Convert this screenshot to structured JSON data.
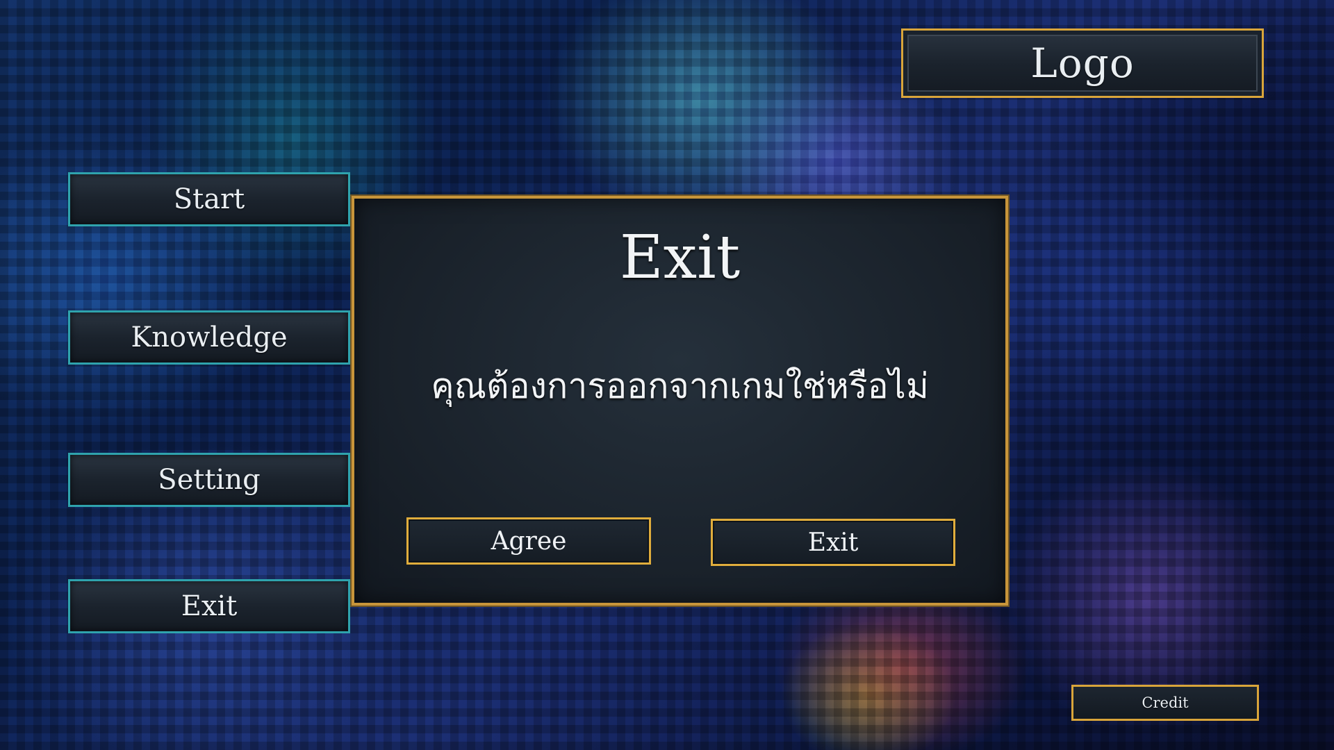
{
  "logo": {
    "label": "Logo"
  },
  "menu": {
    "items": [
      {
        "id": "start",
        "label": "Start"
      },
      {
        "id": "knowledge",
        "label": "Knowledge"
      },
      {
        "id": "setting",
        "label": "Setting"
      },
      {
        "id": "exit",
        "label": "Exit"
      }
    ]
  },
  "dialog": {
    "title": "Exit",
    "message": "คุณต้องการออกจากเกมใช่หรือไม่",
    "agree_label": "Agree",
    "exit_label": "Exit"
  },
  "credit": {
    "label": "Credit"
  },
  "colors": {
    "gold_border": "#d9a53a",
    "teal_border": "#2fa3ad",
    "panel_bg": "#1a222b",
    "text": "#f2f4f6"
  }
}
